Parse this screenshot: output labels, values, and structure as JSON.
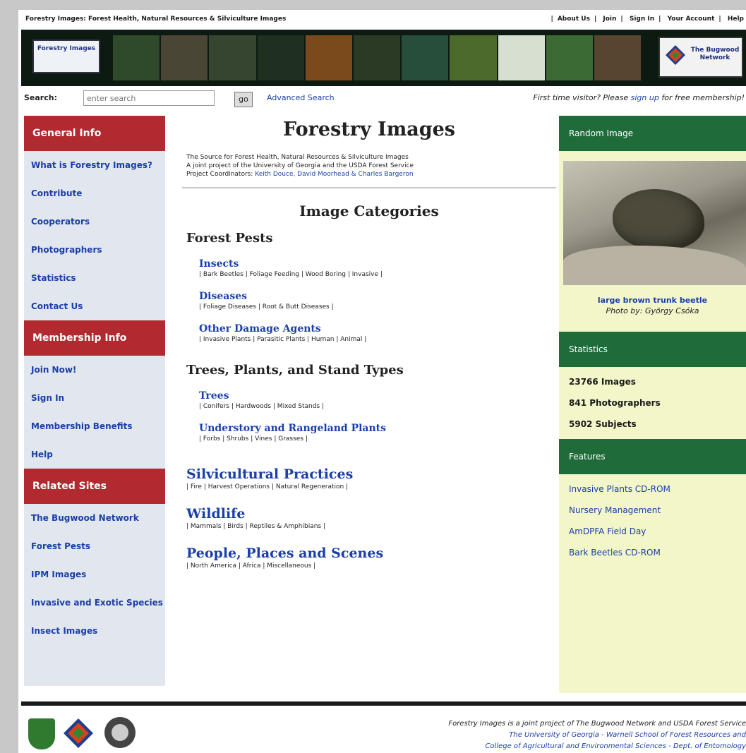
{
  "top": {
    "breadcrumb": "Forestry Images: Forest Health, Natural Resources & Silviculture Images",
    "links": [
      "About Us",
      "Join",
      "Sign In",
      "Your Account",
      "Help"
    ]
  },
  "banner": {
    "left_logo_text": "Forestry Images",
    "right_logo_text": "The Bugwood Network"
  },
  "search": {
    "label": "Search:",
    "placeholder": "enter search",
    "go_label": "go",
    "advanced": "Advanced Search",
    "first_time_prefix": "First time visitor? Please ",
    "first_time_link": "sign up",
    "first_time_suffix": " for free membership!"
  },
  "left_sidebar": {
    "general_heading": "General Info",
    "general_items": [
      "What is Forestry Images?",
      "Contribute",
      "Cooperators",
      "Photographers",
      "Statistics",
      "Contact Us"
    ],
    "membership_heading": "Membership Info",
    "membership_items": [
      "Join Now!",
      "Sign In",
      "Membership Benefits",
      "Help"
    ],
    "related_heading": "Related Sites",
    "related_items": [
      "The Bugwood Network",
      "Forest Pests",
      "IPM Images",
      "Invasive and Exotic Species",
      "Insect Images"
    ]
  },
  "center": {
    "title": "Forestry Images",
    "subtitle_1": "The Source for Forest Health, Natural Resources & Silviculture Images",
    "subtitle_2": "A joint project of the University of Georgia and the USDA Forest Service",
    "subtitle_3_prefix": "Project Coordinators: ",
    "subtitle_3_links": "Keith Douce, David Moorhead & Charles Bargeron",
    "categories_heading": "Image Categories",
    "forest_pests_heading": "Forest Pests",
    "insects": {
      "name": "Insects",
      "items": "| Bark Beetles | Foliage Feeding | Wood Boring | Invasive |"
    },
    "diseases": {
      "name": "Diseases",
      "items": "| Foliage Diseases | Root & Butt Diseases |"
    },
    "other_damage": {
      "name": "Other Damage Agents",
      "items": "| Invasive Plants | Parasitic Plants | Human | Animal |"
    },
    "trees_heading": "Trees, Plants, and Stand Types",
    "trees": {
      "name": "Trees",
      "items": "| Conifers | Hardwoods | Mixed Stands |"
    },
    "understory": {
      "name": "Understory and Rangeland Plants",
      "items": "| Forbs | Shrubs | Vines | Grasses |"
    },
    "silviculture": {
      "name": "Silvicultural Practices",
      "items": "| Fire | Harvest Operations | Natural Regeneration |"
    },
    "wildlife": {
      "name": "Wildlife",
      "items": "| Mammals | Birds | Reptiles & Amphibians |"
    },
    "people": {
      "name": "People, Places and Scenes",
      "items": "| North America | Africa | Miscellaneous |"
    }
  },
  "right_sidebar": {
    "random_heading": "Random Image",
    "caption_title": "large brown trunk beetle",
    "caption_by": "Photo by: György Csóka",
    "statistics_heading": "Statistics",
    "stats": [
      "23766 Images",
      "841 Photographers",
      "5902 Subjects"
    ],
    "features_heading": "Features",
    "features": [
      "Invasive Plants CD-ROM",
      "Nursery Management",
      "AmDPFA Field Day",
      "Bark Beetles CD-ROM"
    ]
  },
  "footer": {
    "line1": "Forestry Images is a joint project of The Bugwood Network and USDA Forest Service",
    "line2": "The University of Georgia - Warnell School of Forest Resources and",
    "line3": "College of Agricultural and Environmental Sciences - Dept. of Entomology"
  },
  "colors": {
    "red_heading": "#b02a30",
    "green_heading": "#1f6b3a",
    "link_blue": "#1a3fa8",
    "left_bg": "#e2e6ee",
    "right_bg": "#f2f6c8"
  }
}
